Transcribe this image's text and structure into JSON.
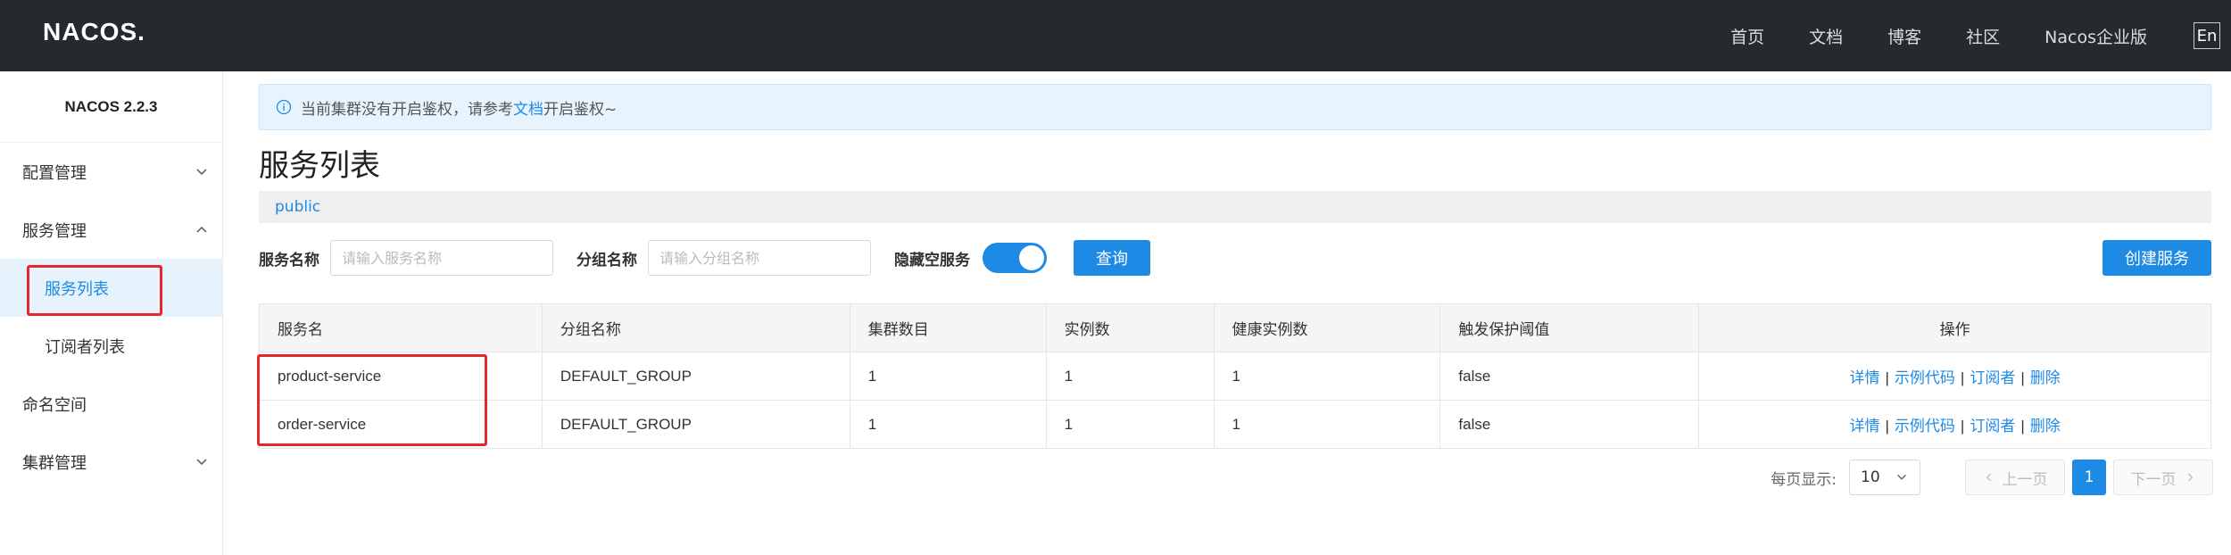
{
  "topbar": {
    "logo": "NACOS.",
    "nav": [
      "首页",
      "文档",
      "博客",
      "社区",
      "Nacos企业版"
    ],
    "lang": "En"
  },
  "sidebar": {
    "version": "NACOS 2.2.3",
    "items": [
      {
        "label": "配置管理"
      },
      {
        "label": "服务管理"
      },
      {
        "label": "服务列表"
      },
      {
        "label": "订阅者列表"
      },
      {
        "label": "命名空间"
      },
      {
        "label": "集群管理"
      }
    ]
  },
  "alert": {
    "prefix": "当前集群没有开启鉴权，请参考",
    "link": "文档",
    "suffix": "开启鉴权~"
  },
  "page": {
    "title": "服务列表",
    "namespace": "public"
  },
  "filter": {
    "service_label": "服务名称",
    "service_placeholder": "请输入服务名称",
    "group_label": "分组名称",
    "group_placeholder": "请输入分组名称",
    "hide_empty_label": "隐藏空服务",
    "hide_empty_on": true,
    "query_button": "查询",
    "create_button": "创建服务"
  },
  "table": {
    "headers": [
      "服务名",
      "分组名称",
      "集群数目",
      "实例数",
      "健康实例数",
      "触发保护阈值",
      "操作"
    ],
    "rows": [
      {
        "name": "product-service",
        "group": "DEFAULT_GROUP",
        "clusters": "1",
        "instances": "1",
        "healthy": "1",
        "threshold": "false"
      },
      {
        "name": "order-service",
        "group": "DEFAULT_GROUP",
        "clusters": "1",
        "instances": "1",
        "healthy": "1",
        "threshold": "false"
      }
    ],
    "ops": [
      "详情",
      "示例代码",
      "订阅者",
      "删除"
    ]
  },
  "pager": {
    "size_label": "每页显示:",
    "size": "10",
    "prev": "上一页",
    "current": "1",
    "next": "下一页"
  },
  "colors": {
    "accent": "#1d8ae6",
    "topbar": "#252a2f",
    "highlight": "#e8262c"
  }
}
